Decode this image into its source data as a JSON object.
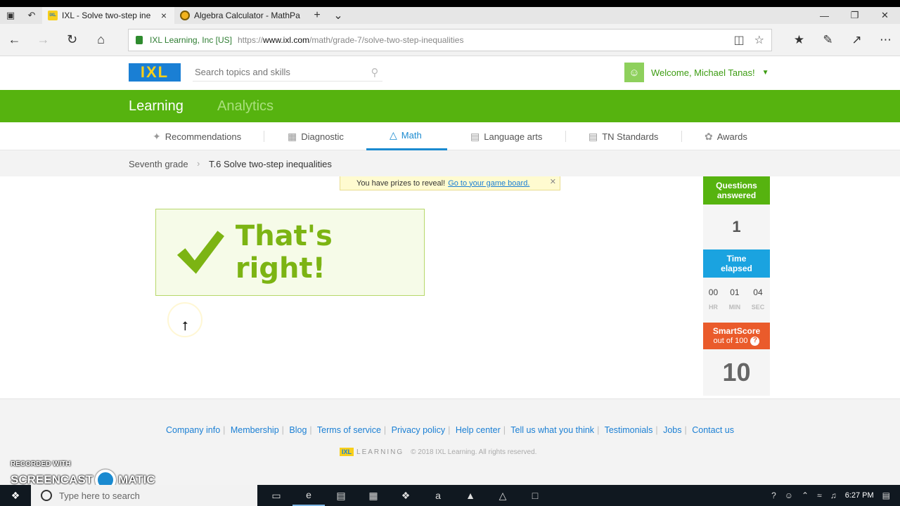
{
  "browser": {
    "tabs": [
      {
        "title": "IXL - Solve two-step ine",
        "active": true,
        "favicon": "ixl-favicon"
      },
      {
        "title": "Algebra Calculator - MathPa",
        "active": false,
        "favicon": "mathpapa-favicon"
      }
    ],
    "org": "IXL Learning, Inc [US]",
    "url_prefix": "https://",
    "url_host": "www.ixl.com",
    "url_path": "/math/grade-7/solve-two-step-inequalities"
  },
  "ixl": {
    "logo": "IXL",
    "search_placeholder": "Search topics and skills",
    "welcome": "Welcome, Michael Tanas!",
    "main_nav": {
      "learning": "Learning",
      "analytics": "Analytics"
    },
    "subnav": [
      {
        "label": "Recommendations",
        "icon": "recommendations-icon"
      },
      {
        "label": "Diagnostic",
        "icon": "diagnostic-icon"
      },
      {
        "label": "Math",
        "icon": "math-icon",
        "active": true
      },
      {
        "label": "Language arts",
        "icon": "book-icon"
      },
      {
        "label": "TN Standards",
        "icon": "standards-icon"
      },
      {
        "label": "Awards",
        "icon": "awards-icon"
      }
    ],
    "breadcrumb": {
      "grade": "Seventh grade",
      "skill": "T.6 Solve two-step inequalities"
    },
    "prize": {
      "text": "You have prizes to reveal!",
      "link": "Go to your game board."
    },
    "feedback": "That's right!",
    "stats": {
      "questions_label_1": "Questions",
      "questions_label_2": "answered",
      "questions_value": "1",
      "time_label_1": "Time",
      "time_label_2": "elapsed",
      "time_hr": "00",
      "time_min": "01",
      "time_sec": "04",
      "unit_hr": "HR",
      "unit_min": "MIN",
      "unit_sec": "SEC",
      "smartscore_label": "SmartScore",
      "smartscore_sub": "out of 100",
      "smartscore_value": "10"
    },
    "footer_links": [
      "Company info",
      "Membership",
      "Blog",
      "Terms of service",
      "Privacy policy",
      "Help center",
      "Tell us what you think",
      "Testimonials",
      "Jobs",
      "Contact us"
    ],
    "footer_logo_text": "LEARNING",
    "copyright": "© 2018 IXL Learning. All rights reserved."
  },
  "watermark": {
    "line1": "RECORDED WITH",
    "brand_a": "SCREENCAST",
    "brand_b": "MATIC"
  },
  "taskbar": {
    "search_placeholder": "Type here to search",
    "time": "6:27 PM"
  },
  "colors": {
    "ixl_green": "#56b30f",
    "ixl_blue": "#1a7fd4",
    "time_blue": "#1aa3e0",
    "smartscore_orange": "#ea5b2b",
    "correct_green": "#7cb413"
  }
}
